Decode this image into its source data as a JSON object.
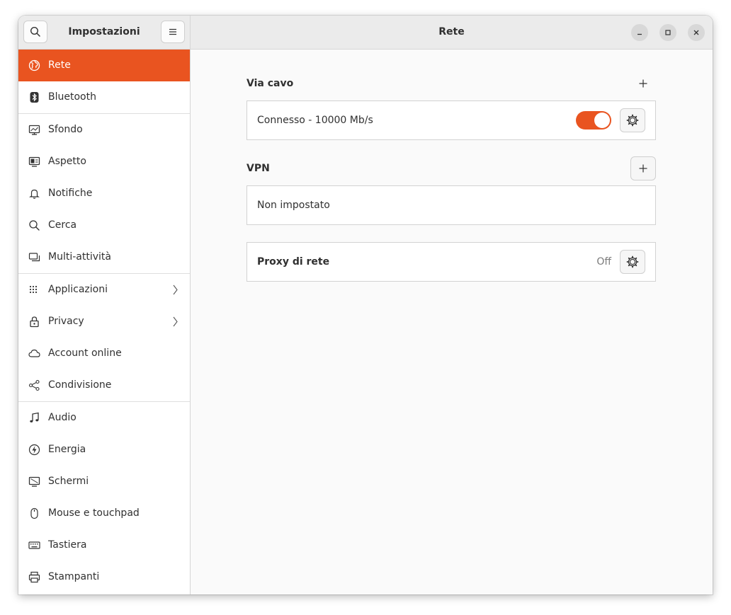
{
  "sidebar": {
    "title": "Impostazioni",
    "items": [
      {
        "label": "Rete",
        "icon": "globe-icon",
        "active": true
      },
      {
        "label": "Bluetooth",
        "icon": "bluetooth-icon"
      },
      {
        "label": "Sfondo",
        "icon": "monitor-icon"
      },
      {
        "label": "Aspetto",
        "icon": "appearance-icon"
      },
      {
        "label": "Notifiche",
        "icon": "bell-icon"
      },
      {
        "label": "Cerca",
        "icon": "search-icon"
      },
      {
        "label": "Multi-attività",
        "icon": "multitasking-icon"
      },
      {
        "label": "Applicazioni",
        "icon": "apps-grid-icon",
        "chevron": true
      },
      {
        "label": "Privacy",
        "icon": "lock-icon",
        "chevron": true
      },
      {
        "label": "Account online",
        "icon": "cloud-icon"
      },
      {
        "label": "Condivisione",
        "icon": "share-icon"
      },
      {
        "label": "Audio",
        "icon": "music-note-icon"
      },
      {
        "label": "Energia",
        "icon": "power-icon"
      },
      {
        "label": "Schermi",
        "icon": "display-icon"
      },
      {
        "label": "Mouse e touchpad",
        "icon": "mouse-icon"
      },
      {
        "label": "Tastiera",
        "icon": "keyboard-icon"
      },
      {
        "label": "Stampanti",
        "icon": "printer-icon"
      }
    ]
  },
  "header": {
    "title": "Rete"
  },
  "wired": {
    "title": "Via cavo",
    "connection_label": "Connesso - 10000 Mb/s",
    "enabled": true
  },
  "vpn": {
    "title": "VPN",
    "status": "Non impostato"
  },
  "proxy": {
    "label": "Proxy di rete",
    "status": "Off"
  },
  "colors": {
    "accent": "#e95420",
    "headerbar": "#ebebeb",
    "background": "#fafafa"
  }
}
